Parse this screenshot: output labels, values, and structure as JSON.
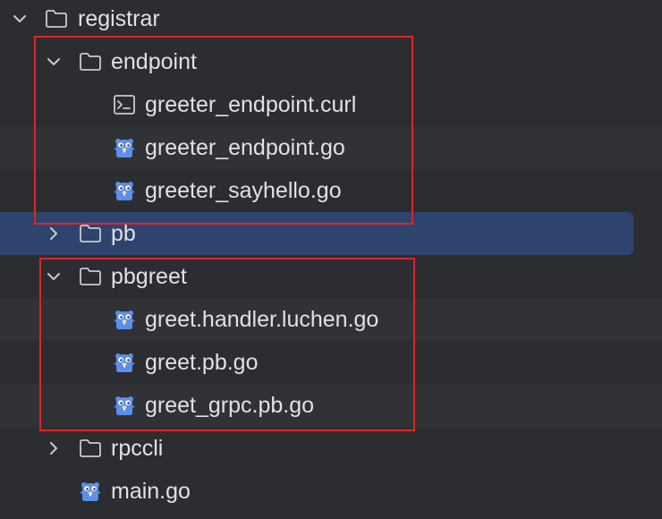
{
  "tree": {
    "items": [
      {
        "label": "registrar",
        "type": "folder",
        "expanded": true
      },
      {
        "label": "endpoint",
        "type": "folder",
        "expanded": true
      },
      {
        "label": "greeter_endpoint.curl",
        "type": "curl-file"
      },
      {
        "label": "greeter_endpoint.go",
        "type": "go-file"
      },
      {
        "label": "greeter_sayhello.go",
        "type": "go-file"
      },
      {
        "label": "pb",
        "type": "folder",
        "expanded": false,
        "selected": true
      },
      {
        "label": "pbgreet",
        "type": "folder",
        "expanded": true
      },
      {
        "label": "greet.handler.luchen.go",
        "type": "go-file"
      },
      {
        "label": "greet.pb.go",
        "type": "go-file"
      },
      {
        "label": "greet_grpc.pb.go",
        "type": "go-file"
      },
      {
        "label": "rpccli",
        "type": "folder",
        "expanded": false
      },
      {
        "label": "main.go",
        "type": "go-file"
      }
    ]
  },
  "colors": {
    "background": "#2b2d30",
    "selection": "#2e436e",
    "highlight_box": "#e0242a",
    "gopher": "#5b8fe8"
  }
}
